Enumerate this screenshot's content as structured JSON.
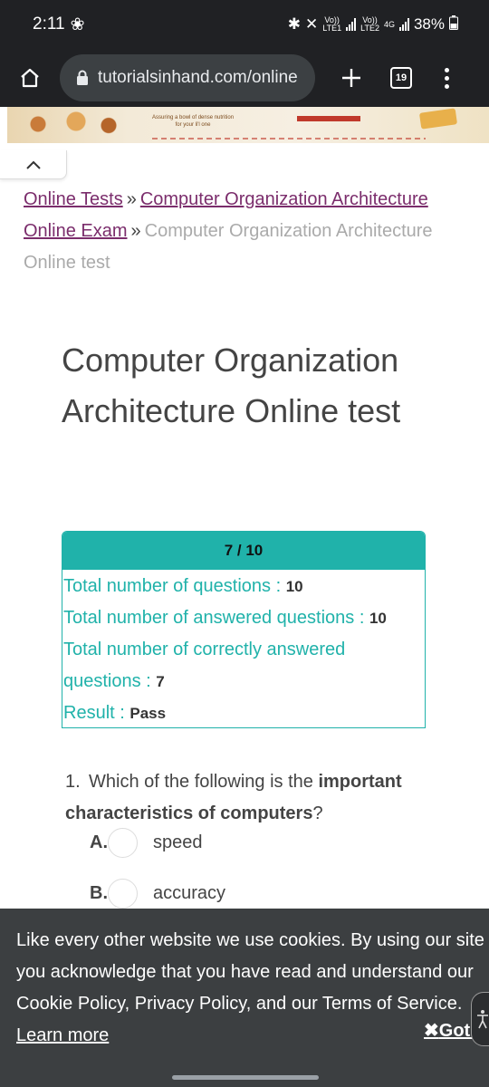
{
  "status_bar": {
    "time": "2:11",
    "lte1": "LTE1",
    "lte2": "LTE2",
    "volte": "Vo))",
    "net_type": "4G",
    "battery": "38%"
  },
  "browser": {
    "url": "tutorialsinhand.com/online",
    "tab_count": "19"
  },
  "ad": {
    "text_line1": "Assuring a bowl of dense nutrition",
    "text_line2": "for your li'l one"
  },
  "breadcrumb": {
    "link1": "Online Tests",
    "link2": "Computer Organization Architecture Online Exam",
    "current": "Computer Organization Architecture Online test",
    "separator": "»"
  },
  "page": {
    "title": "Computer Organization Architecture Online test"
  },
  "result": {
    "score": "7 / 10",
    "total_label": "Total number of questions : ",
    "total_value": "10",
    "answered_label": "Total number of answered questions : ",
    "answered_value": "10",
    "correct_label": "Total number of correctly answered questions : ",
    "correct_value": "7",
    "result_label": "Result : ",
    "result_value": "Pass"
  },
  "question1": {
    "number": "1.",
    "text_a": "Which of the following is the ",
    "text_bold1": "important characteristics of computers",
    "text_b": "?",
    "options": [
      {
        "letter": "A.",
        "text": "speed"
      },
      {
        "letter": "B.",
        "text": "accuracy"
      }
    ]
  },
  "cookie": {
    "text": "Like every other website we use cookies. By using our site you acknowledge that you have read and understand our Cookie Policy, Privacy Policy, and our Terms of Service. ",
    "learn_more": "Learn more",
    "got_it": "Got it"
  },
  "colors": {
    "teal": "#20b2aa",
    "link": "#7b2d6c",
    "chrome_bg": "#202124",
    "cookie_bg": "#3c3f41"
  }
}
